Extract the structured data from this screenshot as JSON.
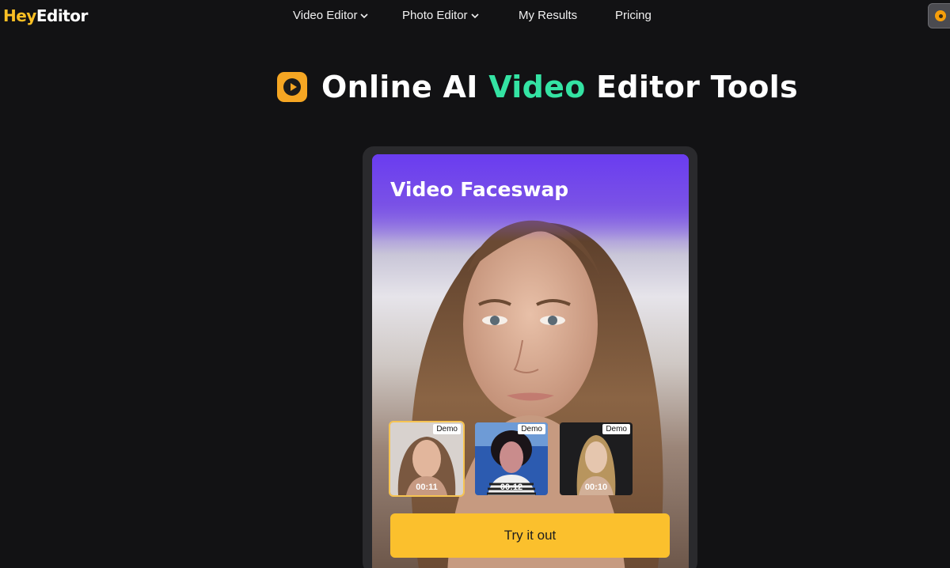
{
  "brand": {
    "part1": "Hey",
    "part2": "Editor"
  },
  "nav": {
    "items": [
      {
        "label": "Video Editor",
        "dropdown": true
      },
      {
        "label": "Photo Editor",
        "dropdown": true
      },
      {
        "label": "My Results",
        "dropdown": false
      },
      {
        "label": "Pricing",
        "dropdown": false
      }
    ]
  },
  "headline": {
    "part1": "Online AI ",
    "accent": "Video",
    "part2": " Editor Tools"
  },
  "card": {
    "title": "Video Faceswap",
    "thumbnails": [
      {
        "badge": "Demo",
        "duration": "00:11",
        "selected": true
      },
      {
        "badge": "Demo",
        "duration": "00:12",
        "selected": false
      },
      {
        "badge": "Demo",
        "duration": "00:10",
        "selected": false
      }
    ],
    "cta_label": "Try it out"
  },
  "colors": {
    "background": "#121214",
    "accent_green": "#34e3a3",
    "brand_yellow": "#fbbf24",
    "cta_yellow": "#fbc02d",
    "card_purple": "#6a3cf0"
  },
  "icons": [
    "chevron-down-icon",
    "play-icon",
    "extension-icon"
  ]
}
